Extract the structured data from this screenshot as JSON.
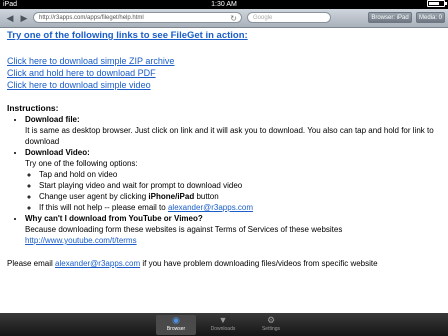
{
  "status": {
    "device": "iPad",
    "time": "1:30 AM"
  },
  "toolbar": {
    "url": "http://r3apps.com/apps/fileget/help.html",
    "search_placeholder": "Google",
    "browser_button": "Browser: iPad",
    "media_button": "Media: 0"
  },
  "content": {
    "heading": "Try one of the following links to see FileGet in action:",
    "links": [
      "Click here to download simple ZIP archive",
      "Click and hold here to download PDF",
      "Click here to download simple video"
    ],
    "instructions_title": "Instructions:",
    "download_file": {
      "title": "Download file:",
      "text": "It is same as desktop browser. Just click on link and it will ask you to download. You also can tap and hold for link to download"
    },
    "download_video": {
      "title": "Download Video:",
      "intro": "Try one of the following options:",
      "options": {
        "tap": "Tap and hold on video",
        "play": "Start playing video and wait for prompt to download video",
        "agent_prefix": "Change user agent by clicking",
        "agent_bold": "iPhone/iPad",
        "agent_suffix": "button",
        "help_prefix": "If this will not help -- please email to",
        "email": "alexander@r3apps.com"
      }
    },
    "youtube": {
      "title": "Why can't I download from YouTube or Vimeo?",
      "text": "Because downloading form these websites is against Terms of Services of these websites",
      "link": "http://www.youtube.com/t/terms"
    },
    "footer": {
      "prefix": "Please email",
      "email": "alexander@r3apps.com",
      "suffix": "if you have problem downloading files/videos from specific website"
    }
  },
  "tabs": [
    {
      "label": "Browser"
    },
    {
      "label": "Downloads"
    },
    {
      "label": "Settings"
    }
  ]
}
